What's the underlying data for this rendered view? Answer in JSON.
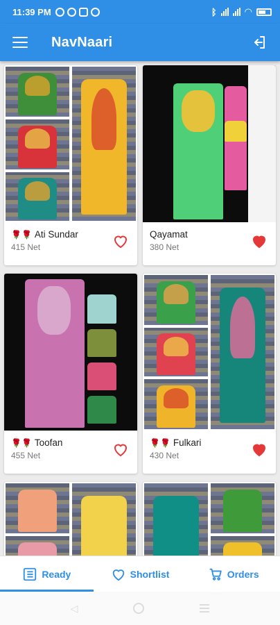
{
  "status_bar": {
    "time": "11:39 PM"
  },
  "app_bar": {
    "title": "NavNaari"
  },
  "products": [
    {
      "name": "Ati Sundar",
      "price": "415 Net",
      "roses": "🌹🌹",
      "shortlisted": false
    },
    {
      "name": "Qayamat",
      "price": "380 Net",
      "roses": "",
      "shortlisted": true
    },
    {
      "name": "Toofan",
      "price": "455 Net",
      "roses": "🌹🌹",
      "shortlisted": false
    },
    {
      "name": "Fulkari",
      "price": "430 Net",
      "roses": "🌹🌹",
      "shortlisted": true
    }
  ],
  "bottom_nav": {
    "tabs": [
      {
        "label": "Ready",
        "icon": "list-icon",
        "active": true
      },
      {
        "label": "Shortlist",
        "icon": "heart-icon",
        "active": false
      },
      {
        "label": "Orders",
        "icon": "cart-icon",
        "active": false
      }
    ]
  },
  "colors": {
    "primary": "#2f8fe6",
    "heart_red": "#e53939"
  }
}
